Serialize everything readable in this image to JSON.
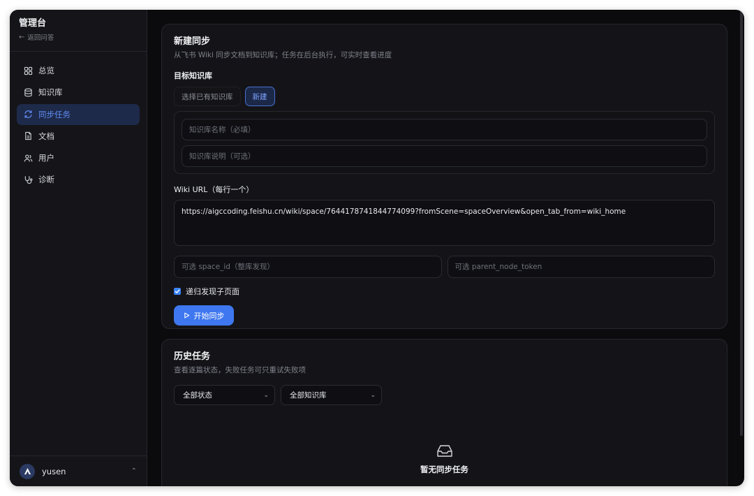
{
  "sidebar": {
    "title": "管理台",
    "back_label": "返回问答",
    "items": [
      {
        "label": "总览",
        "icon": "grid-icon"
      },
      {
        "label": "知识库",
        "icon": "database-icon"
      },
      {
        "label": "同步任务",
        "icon": "refresh-icon"
      },
      {
        "label": "文档",
        "icon": "document-icon"
      },
      {
        "label": "用户",
        "icon": "users-icon"
      },
      {
        "label": "诊断",
        "icon": "stethoscope-icon"
      }
    ],
    "active_index": 2,
    "user": {
      "name": "yusen"
    }
  },
  "new_sync": {
    "title": "新建同步",
    "subtitle": "从飞书 Wiki 同步文档到知识库；任务在后台执行，可实时查看进度",
    "target_label": "目标知识库",
    "tab_existing": "选择已有知识库",
    "tab_new": "新建",
    "kb_name_placeholder": "知识库名称（必填）",
    "kb_desc_placeholder": "知识库说明（可选）",
    "url_label": "Wiki URL（每行一个）",
    "url_value": "https://aigccoding.feishu.cn/wiki/space/7644178741844774099?fromScene=spaceOverview&open_tab_from=wiki_home",
    "space_id_placeholder": "可选 space_id（整库发现）",
    "parent_token_placeholder": "可选 parent_node_token",
    "recursive_label": "递归发现子页面",
    "recursive_checked": true,
    "start_button": "开始同步"
  },
  "history": {
    "title": "历史任务",
    "subtitle": "查看逐篇状态，失败任务可只重试失败项",
    "status_filter": "全部状态",
    "kb_filter": "全部知识库",
    "empty_title": "暂无同步任务"
  },
  "colors": {
    "accent": "#3e77ef",
    "active_nav_bg": "#1e2a4a",
    "active_nav_text": "#5f8bf3"
  }
}
